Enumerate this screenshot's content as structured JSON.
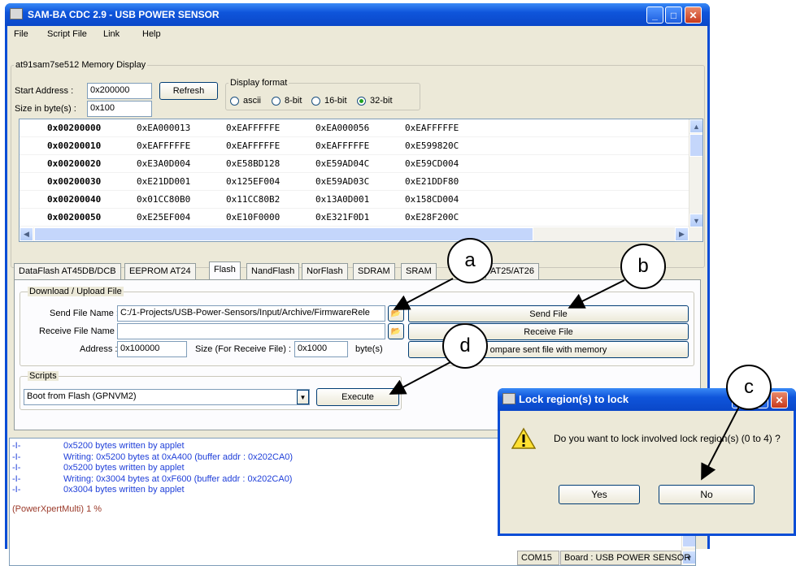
{
  "window": {
    "title": "SAM-BA CDC 2.9  - USB POWER SENSOR",
    "min_glyph": "_",
    "max_glyph": "□",
    "close_glyph": "✕"
  },
  "menu": [
    "File",
    "Script File",
    "Link",
    "Help"
  ],
  "memory": {
    "group_label": "at91sam7se512 Memory Display",
    "start_address_label": "Start Address :",
    "start_address_value": "0x200000",
    "size_label": "Size in byte(s) :",
    "size_value": "0x100",
    "refresh_label": "Refresh",
    "display_format_label": "Display format",
    "formats": [
      "ascii",
      "8-bit",
      "16-bit",
      "32-bit"
    ],
    "selected_format": "32-bit",
    "rows": [
      {
        "addr": "0x00200000",
        "cols": [
          "0xEA000013",
          "0xEAFFFFFE",
          "0xEA000056",
          "0xEAFFFFFE"
        ]
      },
      {
        "addr": "0x00200010",
        "cols": [
          "0xEAFFFFFE",
          "0xEAFFFFFE",
          "0xEAFFFFFE",
          "0xE599820C"
        ]
      },
      {
        "addr": "0x00200020",
        "cols": [
          "0xE3A0D004",
          "0xE58BD128",
          "0xE59AD04C",
          "0xE59CD004"
        ]
      },
      {
        "addr": "0x00200030",
        "cols": [
          "0xE21DD001",
          "0x125EF004",
          "0xE59AD03C",
          "0xE21DDF80"
        ]
      },
      {
        "addr": "0x00200040",
        "cols": [
          "0x01CC80B0",
          "0x11CC80B2",
          "0x13A0D001",
          "0x158CD004"
        ]
      },
      {
        "addr": "0x00200050",
        "cols": [
          "0xE25EF004",
          "0xE10F0000",
          "0xE321F0D1",
          "0xE28F200C"
        ]
      }
    ]
  },
  "tabs": [
    "DataFlash AT45DB/DCB",
    "EEPROM AT24",
    "Flash",
    "NandFlash",
    "NorFlash",
    "SDRAM",
    "SRAM",
    "AT25/AT26"
  ],
  "active_tab": "Flash",
  "flash": {
    "download_group": "Download / Upload File",
    "send_file_label": "Send File Name :",
    "send_file_value": "C:/1-Projects/USB-Power-Sensors/Input/Archive/FirmwareRele",
    "receive_file_label": "Receive File Name :",
    "receive_file_value": "",
    "address_label": "Address :",
    "address_value": "0x100000",
    "size_label": "Size (For Receive File) :",
    "size_value": "0x1000",
    "size_unit": "byte(s)",
    "send_button": "Send File",
    "receive_button": "Receive File",
    "compare_button": "ompare sent file with memory",
    "scripts_group": "Scripts",
    "script_selected": "Boot from Flash (GPNVM2)",
    "execute_button": "Execute"
  },
  "log": [
    {
      "tag": "-I-",
      "text": "0x5200 bytes written by applet"
    },
    {
      "tag": "-I-",
      "text": "Writing: 0x5200 bytes at 0xA400 (buffer addr : 0x202CA0)"
    },
    {
      "tag": "-I-",
      "text": "0x5200 bytes written by applet"
    },
    {
      "tag": "-I-",
      "text": "Writing: 0x3004 bytes at 0xF600 (buffer addr : 0x202CA0)"
    },
    {
      "tag": "-I-",
      "text": "0x3004 bytes written by applet"
    }
  ],
  "log_prompt": "(PowerXpertMulti) 1 %",
  "status": {
    "port": "COM15",
    "board": "Board : USB POWER SENSOR"
  },
  "dialog": {
    "title": "Lock region(s) to lock",
    "message": "Do you want to lock involved lock region(s) (0 to 4) ?",
    "yes": "Yes",
    "no": "No"
  },
  "callouts": {
    "a": "a",
    "b": "b",
    "c": "c",
    "d": "d"
  },
  "colors": {
    "log_text": "#1f3fd9",
    "log_prompt": "#9b3a2a",
    "title_bar": "#0a4dd6"
  }
}
